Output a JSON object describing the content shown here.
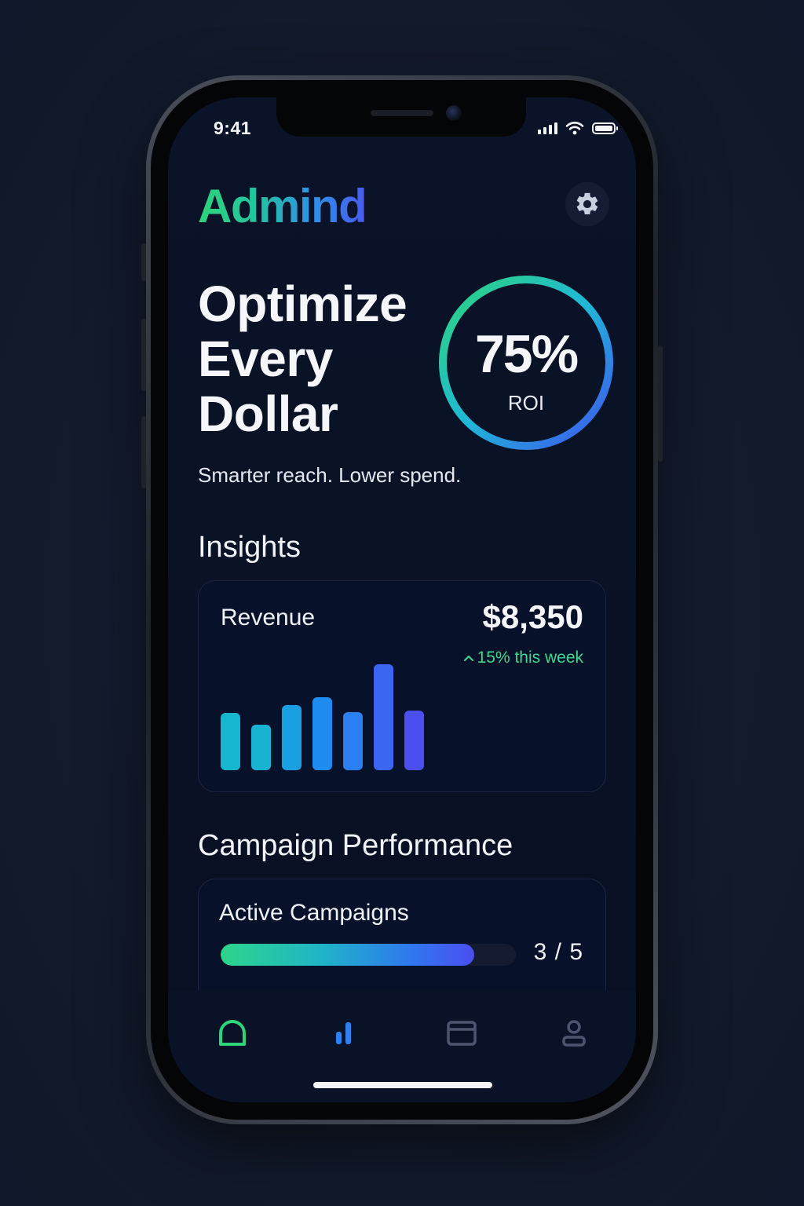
{
  "status_bar": {
    "time": "9:41",
    "icons": [
      "signal-icon",
      "wifi-icon",
      "battery-icon"
    ]
  },
  "header": {
    "brand": "Admind",
    "brand_colors": [
      "#2ed47a",
      "#2f8fe8",
      "#4a58f0"
    ],
    "settings_icon": "gear-icon"
  },
  "hero": {
    "title_lines": [
      "Optimize",
      "Every",
      "Dollar"
    ],
    "subtitle": "Smarter reach. Lower spend.",
    "roi": {
      "value": "75%",
      "label": "ROI",
      "ring_colors": [
        "#2ed47a",
        "#1fb8d8",
        "#3f52ee"
      ]
    }
  },
  "insights": {
    "title": "Insights",
    "revenue": {
      "label": "Revenue",
      "value": "$8,350",
      "change": "15% this week",
      "change_icon": "chevron-up-icon",
      "change_color": "#3ed98c"
    }
  },
  "chart_data": {
    "type": "bar",
    "values": [
      73,
      58,
      83,
      93,
      74,
      135,
      76
    ]
  },
  "campaign": {
    "title": "Campaign Performance",
    "card_label": "Active Campaigns",
    "count": "3 / 5",
    "progress_fraction": 0.86
  },
  "tab_bar": {
    "items": [
      {
        "icon": "home-icon",
        "active": true,
        "color": "#2ed47a"
      },
      {
        "icon": "bar-chart-icon",
        "active": false,
        "color": "#2f80f0"
      },
      {
        "icon": "card-icon",
        "active": false,
        "color": "#4c5570"
      },
      {
        "icon": "user-icon",
        "active": false,
        "color": "#4c5570"
      }
    ]
  }
}
